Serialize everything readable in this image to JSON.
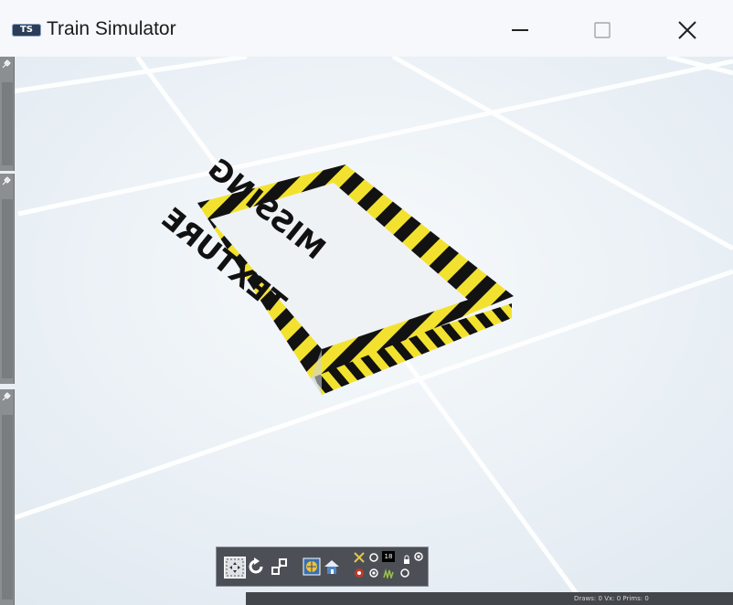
{
  "window": {
    "title": "Train Simulator",
    "logo_text": "TS"
  },
  "scene": {
    "sign_line1": "MISSING",
    "sign_line2": "TEXTURE",
    "stripe_colors": [
      "#f2e22f",
      "#111111"
    ]
  },
  "toolbar": {
    "icons": [
      "select-icon",
      "rotate-icon",
      "move-icon",
      "globe-icon",
      "home-icon",
      "tool-icon",
      "camera-icon",
      "radio-icon",
      "counter-display",
      "lock-icon",
      "grass-icon"
    ],
    "counter_value": "18"
  },
  "statusbar": {
    "text": "Draws: 0 Vx: 0 Prims: 0"
  }
}
